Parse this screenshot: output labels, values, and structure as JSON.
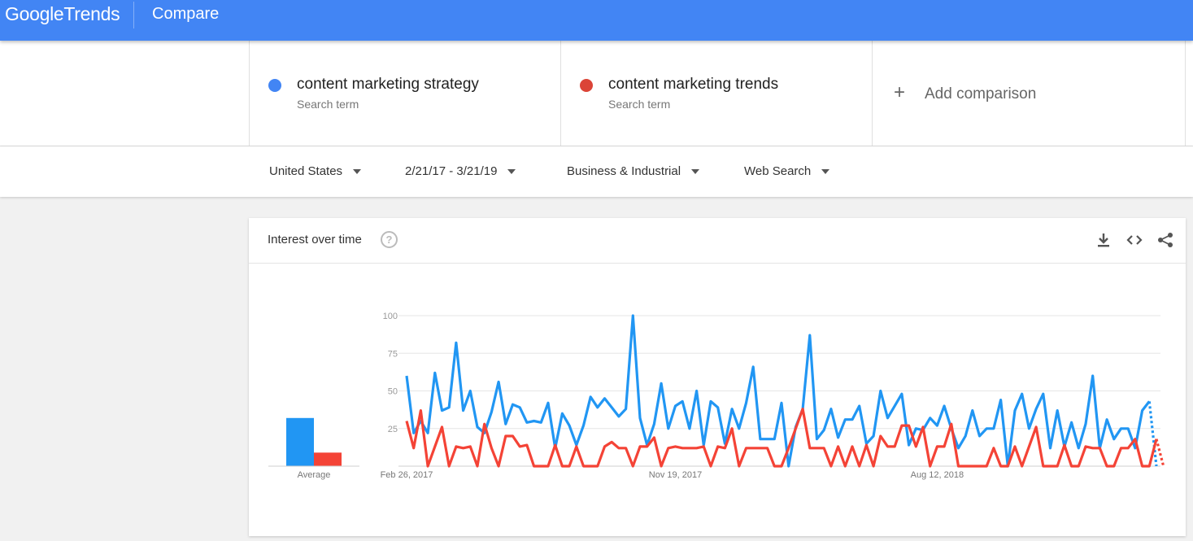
{
  "header": {
    "logo_google": "Google",
    "logo_trends": "Trends",
    "page_title": "Compare"
  },
  "terms": [
    {
      "name": "content marketing strategy",
      "sub": "Search term",
      "color": "#4285f4"
    },
    {
      "name": "content marketing trends",
      "sub": "Search term",
      "color": "#db4437"
    }
  ],
  "add_comparison": "Add comparison",
  "filters": {
    "region": "United States",
    "date_range": "2/21/17 - 3/21/19",
    "category": "Business & Industrial",
    "search_type": "Web Search"
  },
  "card": {
    "title": "Interest over time",
    "help_glyph": "?",
    "icons": [
      "download-icon",
      "embed-icon",
      "share-icon"
    ]
  },
  "chart_data": {
    "type": "line",
    "ylim": [
      0,
      100
    ],
    "y_ticks": [
      "100",
      "75",
      "50",
      "25"
    ],
    "x_tick_labels": [
      "Feb 26, 2017",
      "Nov 19, 2017",
      "Aug 12, 2018"
    ],
    "average_label": "Average",
    "average_values": [
      32,
      9
    ],
    "grid": true,
    "last_point_partial": true,
    "series": [
      {
        "name": "content marketing strategy",
        "color": "#2196f3",
        "values": [
          60,
          22,
          30,
          22,
          62,
          37,
          39,
          82,
          37,
          50,
          26,
          22,
          36,
          56,
          28,
          41,
          39,
          29,
          30,
          29,
          42,
          12,
          35,
          27,
          14,
          27,
          46,
          39,
          45,
          39,
          33,
          38,
          100,
          32,
          14,
          28,
          55,
          25,
          40,
          43,
          25,
          50,
          14,
          43,
          39,
          15,
          38,
          25,
          42,
          66,
          18,
          18,
          18,
          42,
          0,
          26,
          38,
          87,
          18,
          24,
          38,
          19,
          31,
          31,
          40,
          15,
          20,
          50,
          32,
          40,
          48,
          14,
          25,
          24,
          32,
          27,
          40,
          25,
          12,
          20,
          37,
          20,
          25,
          25,
          44,
          0,
          37,
          48,
          25,
          38,
          48,
          12,
          37,
          13,
          29,
          12,
          28,
          60,
          12,
          31,
          18,
          25,
          25,
          12,
          37,
          43,
          0
        ]
      },
      {
        "name": "content marketing trends",
        "color": "#f44336",
        "values": [
          30,
          12,
          37,
          0,
          13,
          26,
          0,
          13,
          12,
          13,
          0,
          28,
          12,
          0,
          20,
          20,
          13,
          14,
          0,
          0,
          0,
          14,
          0,
          0,
          13,
          0,
          0,
          0,
          13,
          16,
          12,
          12,
          0,
          13,
          13,
          19,
          0,
          12,
          13,
          12,
          12,
          12,
          13,
          0,
          13,
          12,
          25,
          0,
          12,
          12,
          12,
          12,
          0,
          0,
          12,
          25,
          38,
          12,
          12,
          12,
          0,
          13,
          0,
          13,
          0,
          14,
          0,
          20,
          13,
          13,
          27,
          27,
          13,
          26,
          0,
          13,
          13,
          28,
          0,
          0,
          0,
          0,
          0,
          12,
          0,
          0,
          13,
          0,
          13,
          26,
          0,
          0,
          0,
          14,
          0,
          0,
          13,
          12,
          12,
          0,
          0,
          12,
          12,
          18,
          0,
          0,
          18,
          0
        ]
      }
    ]
  }
}
